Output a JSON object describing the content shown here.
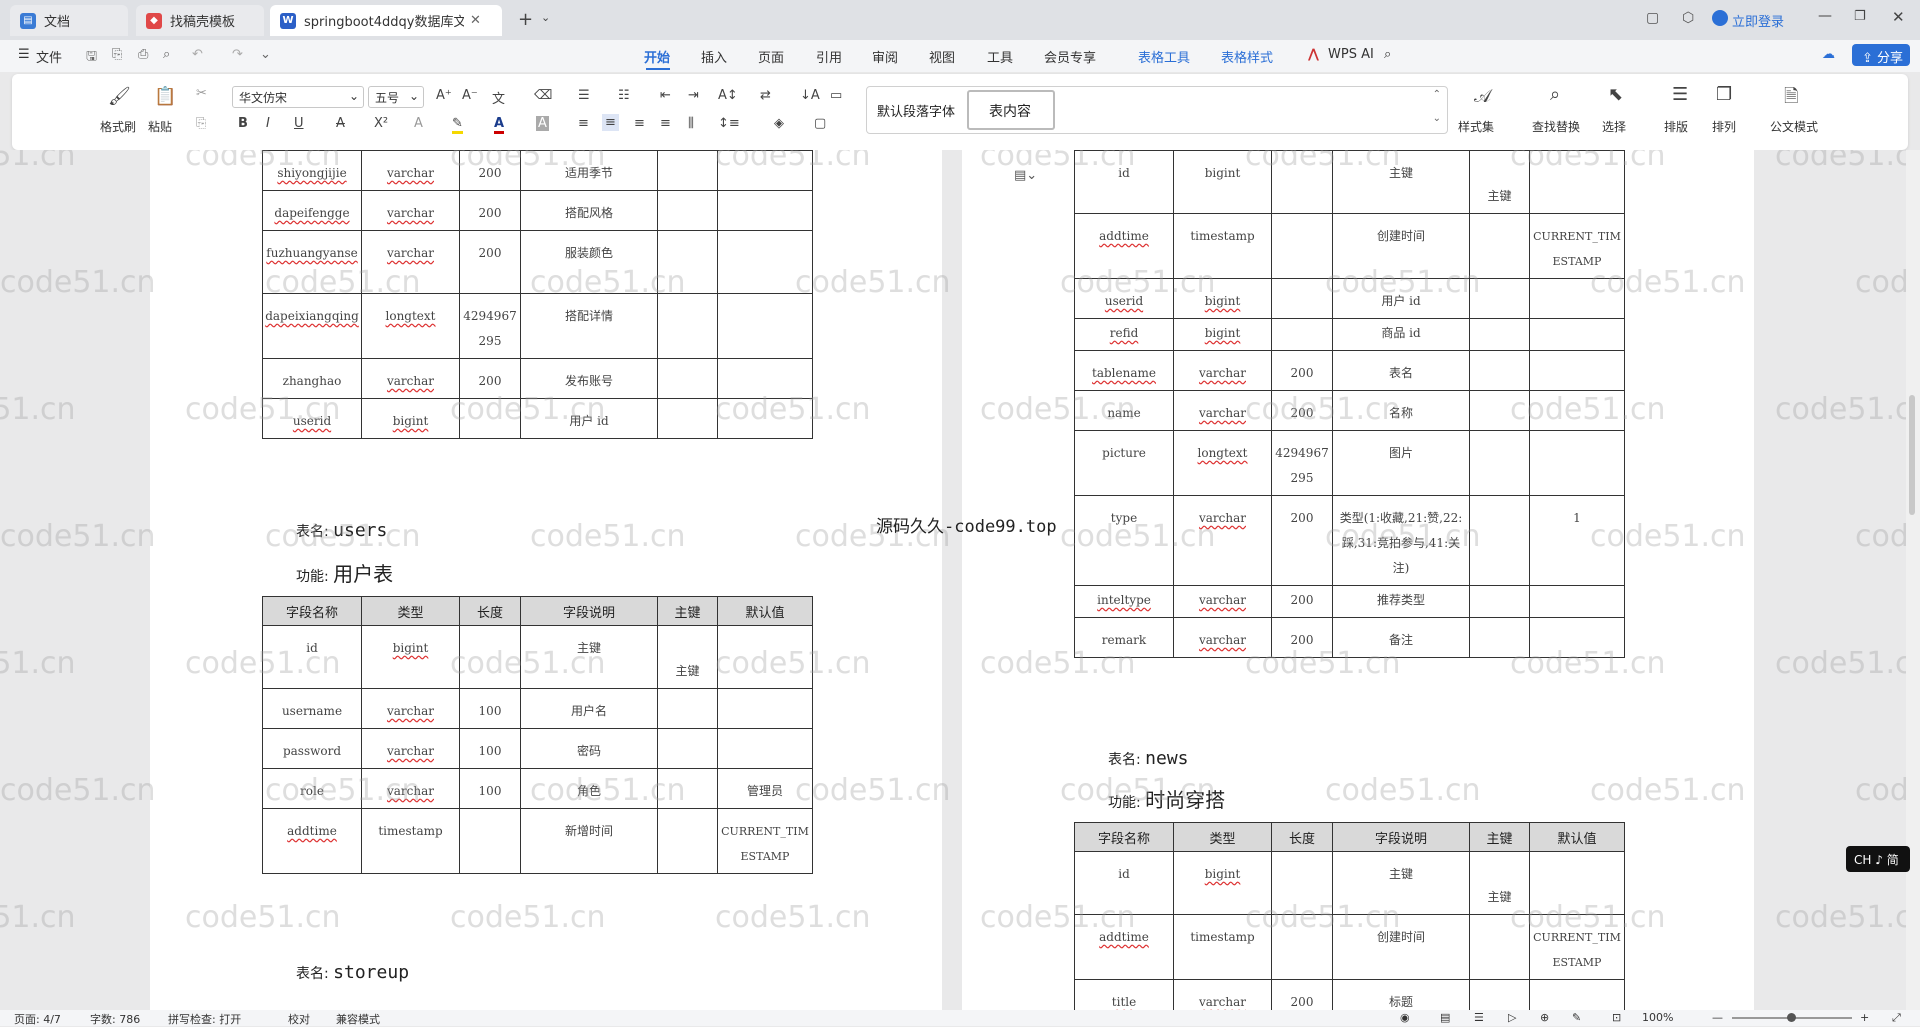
{
  "tabs": [
    {
      "label": "文档",
      "icon": "document-icon"
    },
    {
      "label": "找稿壳模板",
      "icon": "template-icon"
    },
    {
      "label": "springboot4ddqy数据库文",
      "icon": "word-icon"
    }
  ],
  "window": {
    "login": "立即登录"
  },
  "menu": {
    "file": "文件",
    "items": [
      "开始",
      "插入",
      "页面",
      "引用",
      "审阅",
      "视图",
      "工具",
      "会员专享",
      "表格工具",
      "表格样式",
      "WPS AI"
    ],
    "share": "分享"
  },
  "ribbon": {
    "format_painter": "格式刷",
    "paste": "粘贴",
    "font": "华文仿宋",
    "size": "五号",
    "style_default": "默认段落字体",
    "style_table": "表内容",
    "style_set": "样式集",
    "find_replace": "查找替换",
    "select": "选择",
    "sort": "排版",
    "arrange": "排列",
    "official": "公文模式"
  },
  "left_table_top": {
    "rows": [
      [
        "shiyongjijie",
        "varchar",
        "200",
        "适用季节",
        "",
        ""
      ],
      [
        "dapeifengge",
        "varchar",
        "200",
        "搭配风格",
        "",
        ""
      ],
      [
        "fuzhuangyanse",
        "varchar",
        "200",
        "服装颜色",
        "",
        ""
      ],
      [
        "dapeixiangqing",
        "longtext",
        "4294967295",
        "搭配详情",
        "",
        ""
      ],
      [
        "zhanghao",
        "varchar",
        "200",
        "发布账号",
        "",
        ""
      ],
      [
        "userid",
        "bigint",
        "",
        "用户 id",
        "",
        ""
      ]
    ]
  },
  "users_section": {
    "table_label": "表名:",
    "table_name": "users",
    "func_label": "功能:",
    "func_name": "用户表"
  },
  "headers": [
    "字段名称",
    "类型",
    "长度",
    "字段说明",
    "主键",
    "默认值"
  ],
  "users_table": {
    "rows": [
      [
        "id",
        "bigint",
        "",
        "主键",
        "主键",
        ""
      ],
      [
        "username",
        "varchar",
        "100",
        "用户名",
        "",
        ""
      ],
      [
        "password",
        "varchar",
        "100",
        "密码",
        "",
        ""
      ],
      [
        "role",
        "varchar",
        "100",
        "角色",
        "",
        "管理员"
      ],
      [
        "addtime",
        "timestamp",
        "",
        "新增时间",
        "",
        "CURRENT_TIMESTAMP"
      ]
    ]
  },
  "storeup_section": {
    "table_label": "表名:",
    "table_name": "storeup"
  },
  "right_table_top": {
    "rows": [
      [
        "id",
        "bigint",
        "",
        "主键",
        "主键",
        ""
      ],
      [
        "addtime",
        "timestamp",
        "",
        "创建时间",
        "",
        "CURRENT_TIMESTAMP"
      ],
      [
        "userid",
        "bigint",
        "",
        "用户 id",
        "",
        ""
      ],
      [
        "refid",
        "bigint",
        "",
        "商品 id",
        "",
        ""
      ],
      [
        "tablename",
        "varchar",
        "200",
        "表名",
        "",
        ""
      ],
      [
        "name",
        "varchar",
        "200",
        "名称",
        "",
        ""
      ],
      [
        "picture",
        "longtext",
        "4294967295",
        "图片",
        "",
        ""
      ],
      [
        "type",
        "varchar",
        "200",
        "类型(1:收藏,21:赞,22:踩,31:竞拍参与,41:关注)",
        "",
        "1"
      ],
      [
        "inteltype",
        "varchar",
        "200",
        "推荐类型",
        "",
        ""
      ],
      [
        "remark",
        "varchar",
        "200",
        "备注",
        "",
        ""
      ]
    ]
  },
  "news_section": {
    "table_label": "表名:",
    "table_name": "news",
    "func_label": "功能:",
    "func_name": "时尚穿搭"
  },
  "news_table": {
    "rows": [
      [
        "id",
        "bigint",
        "",
        "主键",
        "主键",
        ""
      ],
      [
        "addtime",
        "timestamp",
        "",
        "创建时间",
        "",
        "CURRENT_TIMESTAMP"
      ],
      [
        "title",
        "varchar",
        "200",
        "标题",
        "",
        ""
      ]
    ]
  },
  "overlay_text": "源码久久-code99.top",
  "watermark": "code51.cn",
  "ime": "CH ♪ 简",
  "status": {
    "page": "页面: 4/7",
    "words": "字数: 786",
    "spell": "拼写检查: 打开",
    "proof": "校对",
    "compat": "兼容模式",
    "zoom": "100%"
  }
}
